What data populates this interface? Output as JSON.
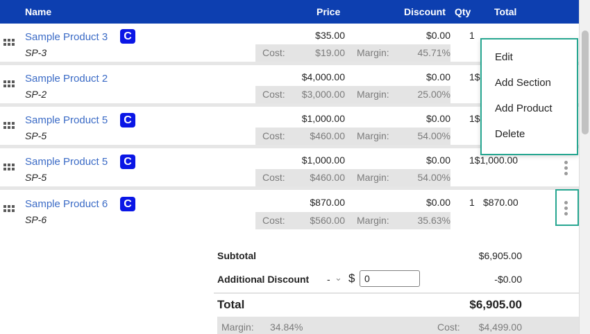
{
  "header": {
    "name": "Name",
    "price": "Price",
    "discount": "Discount",
    "qty": "Qty",
    "total": "Total"
  },
  "labels": {
    "cost": "Cost:",
    "margin": "Margin:"
  },
  "badge": "C",
  "rows": [
    {
      "name": "Sample Product 3",
      "sku": "SP-3",
      "badge": true,
      "price": "$35.00",
      "discount": "$0.00",
      "qty": "1",
      "total": "",
      "cost": "$19.00",
      "margin": "45.71%"
    },
    {
      "name": "Sample Product 2",
      "sku": "SP-2",
      "badge": false,
      "price": "$4,000.00",
      "discount": "$0.00",
      "qty": "1$",
      "total": "",
      "cost": "$3,000.00",
      "margin": "25.00%"
    },
    {
      "name": "Sample Product 5",
      "sku": "SP-5",
      "badge": true,
      "price": "$1,000.00",
      "discount": "$0.00",
      "qty": "1$",
      "total": "",
      "cost": "$460.00",
      "margin": "54.00%"
    },
    {
      "name": "Sample Product 5",
      "sku": "SP-5",
      "badge": true,
      "price": "$1,000.00",
      "discount": "$0.00",
      "qty": "1$1,000.00",
      "total": "",
      "cost": "$460.00",
      "margin": "54.00%"
    },
    {
      "name": "Sample Product 6",
      "sku": "SP-6",
      "badge": true,
      "price": "$870.00",
      "discount": "$0.00",
      "qty": "1",
      "total": "$870.00",
      "cost": "$560.00",
      "margin": "35.63%"
    }
  ],
  "context_menu": {
    "items": [
      "Edit",
      "Add Section",
      "Add Product",
      "Delete"
    ]
  },
  "summary": {
    "subtotal_label": "Subtotal",
    "subtotal_value": "$6,905.00",
    "discount_label": "Additional Discount",
    "discount_type": "-",
    "currency_symbol": "$",
    "discount_input": "0",
    "discount_value": "-$0.00",
    "total_label": "Total",
    "total_value": "$6,905.00",
    "margin_label": "Margin:",
    "margin_value": "34.84%",
    "cost_label": "Cost:",
    "cost_value": "$4,499.00"
  },
  "colors": {
    "header_bg": "#0d3fb0",
    "product_link": "#3b6bc6",
    "badge_bg": "#0a16e6",
    "highlight": "#26a690"
  }
}
